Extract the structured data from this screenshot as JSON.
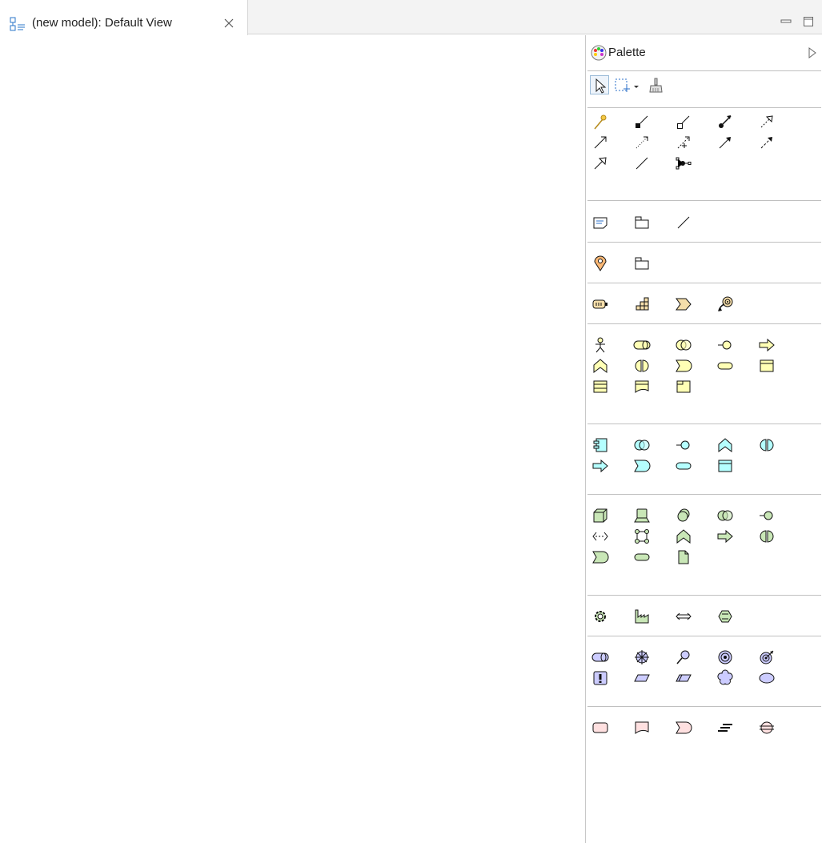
{
  "editor": {
    "tab_title": "(new model): Default View",
    "tab_icon": "diagram-icon",
    "close_icon": "close-icon"
  },
  "window_controls": [
    "minimize-icon",
    "maximize-icon"
  ],
  "palette": {
    "title": "Palette",
    "icon": "palette-icon",
    "collapse_icon": "collapse-arrow-icon",
    "groups": [
      {
        "name": "selection",
        "tools": [
          "select-pointer-icon",
          "marquee-select-icon",
          "format-painter-icon"
        ]
      },
      {
        "name": "relations",
        "tools": [
          "magic-connector-icon",
          "composition-icon",
          "aggregation-icon",
          "assignment-icon",
          "realization-icon",
          "serving-icon",
          "access-icon",
          "influence-icon",
          "triggering-icon",
          "flow-icon",
          "specialization-icon",
          "association-icon",
          "junction-icon"
        ]
      },
      {
        "name": "other",
        "tools": [
          "note-icon",
          "group-icon",
          "connection-icon"
        ]
      },
      {
        "name": "other-elements",
        "tools": [
          "location-icon",
          "grouping-icon"
        ]
      },
      {
        "name": "strategy",
        "tools": [
          "resource-icon",
          "capability-icon",
          "value-stream-icon",
          "course-of-action-icon"
        ]
      },
      {
        "name": "business",
        "tools": [
          "business-actor-icon",
          "business-role-icon",
          "business-collaboration-icon",
          "business-interface-icon",
          "business-process-icon",
          "business-function-icon",
          "business-interaction-icon",
          "business-event-icon",
          "business-service-icon",
          "business-object-icon",
          "contract-icon",
          "representation-icon",
          "product-icon"
        ]
      },
      {
        "name": "application",
        "tools": [
          "application-component-icon",
          "application-collaboration-icon",
          "application-interface-icon",
          "application-function-icon",
          "application-interaction-icon",
          "application-process-icon",
          "application-event-icon",
          "application-service-icon",
          "data-object-icon"
        ]
      },
      {
        "name": "technology",
        "tools": [
          "node-icon",
          "device-icon",
          "system-software-icon",
          "technology-collaboration-icon",
          "technology-interface-icon",
          "path-icon",
          "communication-network-icon",
          "technology-function-icon",
          "technology-process-icon",
          "technology-interaction-icon",
          "technology-event-icon",
          "technology-service-icon",
          "artifact-icon"
        ]
      },
      {
        "name": "physical",
        "tools": [
          "equipment-icon",
          "facility-icon",
          "distribution-network-icon",
          "material-icon"
        ]
      },
      {
        "name": "motivation",
        "tools": [
          "stakeholder-icon",
          "driver-icon",
          "assessment-icon",
          "goal-icon",
          "outcome-icon",
          "principle-icon",
          "requirement-icon",
          "constraint-icon",
          "meaning-icon",
          "value-icon"
        ]
      },
      {
        "name": "implementation",
        "tools": [
          "work-package-icon",
          "deliverable-icon",
          "implementation-event-icon",
          "plateau-icon",
          "gap-icon"
        ]
      }
    ]
  },
  "colors": {
    "business": "#ffffb5",
    "application": "#b5ffff",
    "technology": "#c9e7b7",
    "strategy": "#f5deaa",
    "motivation": "#ccccff",
    "implementation": "#ffe0e0",
    "location": "#fbb875"
  }
}
